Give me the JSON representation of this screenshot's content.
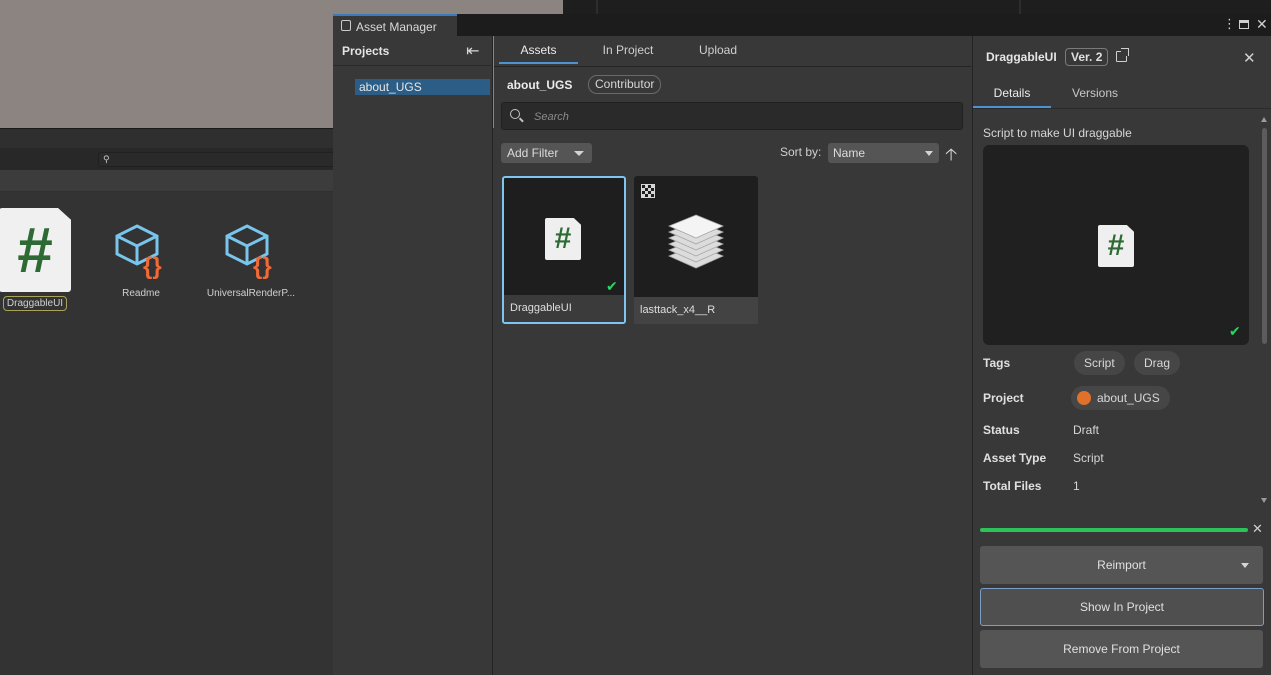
{
  "colors": {
    "accent": "#4d93d1",
    "selected_border": "#7cc6ef",
    "success": "#2bd564",
    "project_avatar": "#e0712a"
  },
  "background": {
    "project_items": [
      {
        "label": "DraggableUI",
        "icon": "csharp-script-icon"
      },
      {
        "label": "Readme",
        "icon": "scriptable-object-icon"
      },
      {
        "label": "UniversalRenderP...",
        "icon": "scriptable-object-icon"
      }
    ]
  },
  "window": {
    "title": "Asset Manager",
    "menu_icon": "kebab-menu-icon",
    "maximize_icon": "maximize-icon",
    "close_icon": "close-icon"
  },
  "projects_panel": {
    "header": "Projects",
    "items": [
      {
        "label": "about_UGS",
        "selected": true
      }
    ]
  },
  "main": {
    "tabs": [
      {
        "label": "Assets",
        "active": true
      },
      {
        "label": "In Project"
      },
      {
        "label": "Upload"
      }
    ],
    "project_name": "about_UGS",
    "role": "Contributor",
    "search": {
      "placeholder": "Search",
      "value": ""
    },
    "add_filter": "Add Filter",
    "sort_label": "Sort by:",
    "sort_value": "Name",
    "assets": [
      {
        "name": "DraggableUI",
        "icon": "csharp-script-icon",
        "imported": true,
        "selected": true
      },
      {
        "name": "lasttack_x4__R",
        "icon": "stack-icon",
        "badge_icon": "texture-icon",
        "imported": false
      }
    ]
  },
  "details": {
    "title": "DraggableUI",
    "version": "Ver. 2",
    "tabs": [
      {
        "label": "Details",
        "active": true
      },
      {
        "label": "Versions"
      }
    ],
    "description": "Script to make UI draggable",
    "tags_label": "Tags",
    "tags": [
      "Script",
      "Drag"
    ],
    "project_label": "Project",
    "project_value": "about_UGS",
    "status_label": "Status",
    "status_value": "Draft",
    "asset_type_label": "Asset Type",
    "asset_type_value": "Script",
    "total_files_label": "Total Files",
    "total_files_value": "1",
    "progress": 1.0,
    "reimport_label": "Reimport",
    "show_in_project_label": "Show In Project",
    "remove_label": "Remove From Project"
  }
}
